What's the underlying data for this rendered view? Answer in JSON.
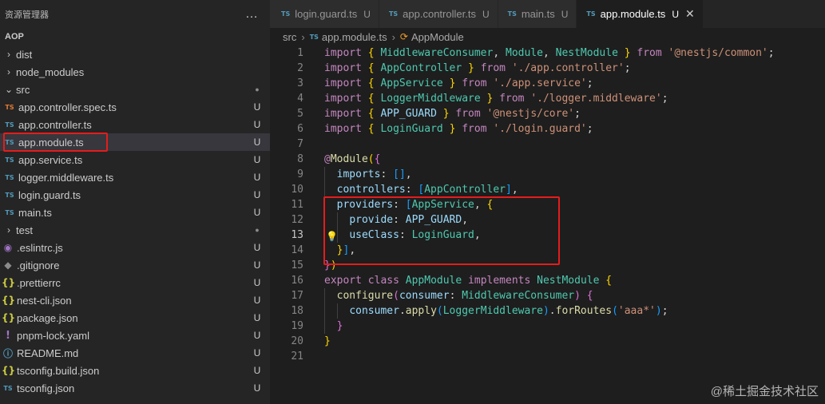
{
  "sidebar": {
    "title": "资源管理器",
    "more_icon": "…",
    "section": "AOP",
    "items": [
      {
        "label": "dist",
        "type": "folder",
        "expanded": false,
        "status": ""
      },
      {
        "label": "node_modules",
        "type": "folder",
        "expanded": false,
        "status": ""
      },
      {
        "label": "src",
        "type": "folder",
        "expanded": true,
        "status": "●"
      },
      {
        "label": "app.controller.spec.ts",
        "type": "spec",
        "status": "U"
      },
      {
        "label": "app.controller.ts",
        "type": "ts",
        "status": "U"
      },
      {
        "label": "app.module.ts",
        "type": "ts",
        "status": "U",
        "selected": true
      },
      {
        "label": "app.service.ts",
        "type": "ts",
        "status": "U"
      },
      {
        "label": "logger.middleware.ts",
        "type": "ts",
        "status": "U"
      },
      {
        "label": "login.guard.ts",
        "type": "ts",
        "status": "U"
      },
      {
        "label": "main.ts",
        "type": "ts",
        "status": "U"
      },
      {
        "label": "test",
        "type": "folder",
        "expanded": false,
        "status": "●"
      },
      {
        "label": ".eslintrc.js",
        "type": "eslint",
        "status": "U"
      },
      {
        "label": ".gitignore",
        "type": "git",
        "status": "U"
      },
      {
        "label": ".prettierrc",
        "type": "json",
        "status": "U"
      },
      {
        "label": "nest-cli.json",
        "type": "json",
        "status": "U"
      },
      {
        "label": "package.json",
        "type": "json",
        "status": "U"
      },
      {
        "label": "pnpm-lock.yaml",
        "type": "yaml",
        "status": "U"
      },
      {
        "label": "README.md",
        "type": "info",
        "status": "U"
      },
      {
        "label": "tsconfig.build.json",
        "type": "json",
        "status": "U"
      },
      {
        "label": "tsconfig.json",
        "type": "tsconfig",
        "status": "U"
      }
    ]
  },
  "tabs": [
    {
      "label": "login.guard.ts",
      "icon": "TS",
      "status": "U",
      "active": false
    },
    {
      "label": "app.controller.ts",
      "icon": "TS",
      "status": "U",
      "active": false
    },
    {
      "label": "main.ts",
      "icon": "TS",
      "status": "U",
      "active": false
    },
    {
      "label": "app.module.ts",
      "icon": "TS",
      "status": "U",
      "active": true
    }
  ],
  "breadcrumb": {
    "folder": "src",
    "file_icon": "TS",
    "file": "app.module.ts",
    "symbol": "AppModule"
  },
  "editor": {
    "current_line": 13,
    "lines": [
      "import { MiddlewareConsumer, Module, NestModule } from '@nestjs/common';",
      "import { AppController } from './app.controller';",
      "import { AppService } from './app.service';",
      "import { LoggerMiddleware } from './logger.middleware';",
      "import { APP_GUARD } from '@nestjs/core';",
      "import { LoginGuard } from './login.guard';",
      "",
      "@Module({",
      "  imports: [],",
      "  controllers: [AppController],",
      "  providers: [AppService, {",
      "    provide: APP_GUARD,",
      "    useClass: LoginGuard,",
      "  }],",
      "})",
      "export class AppModule implements NestModule {",
      "  configure(consumer: MiddlewareConsumer) {",
      "    consumer.apply(LoggerMiddleware).forRoutes('aaa*');",
      "  }",
      "}",
      ""
    ]
  },
  "watermark": "@稀土掘金技术社区",
  "colors": {
    "highlight_box": "#e51c1c",
    "sidebar_bg": "#252526",
    "editor_bg": "#1e1e1e"
  }
}
